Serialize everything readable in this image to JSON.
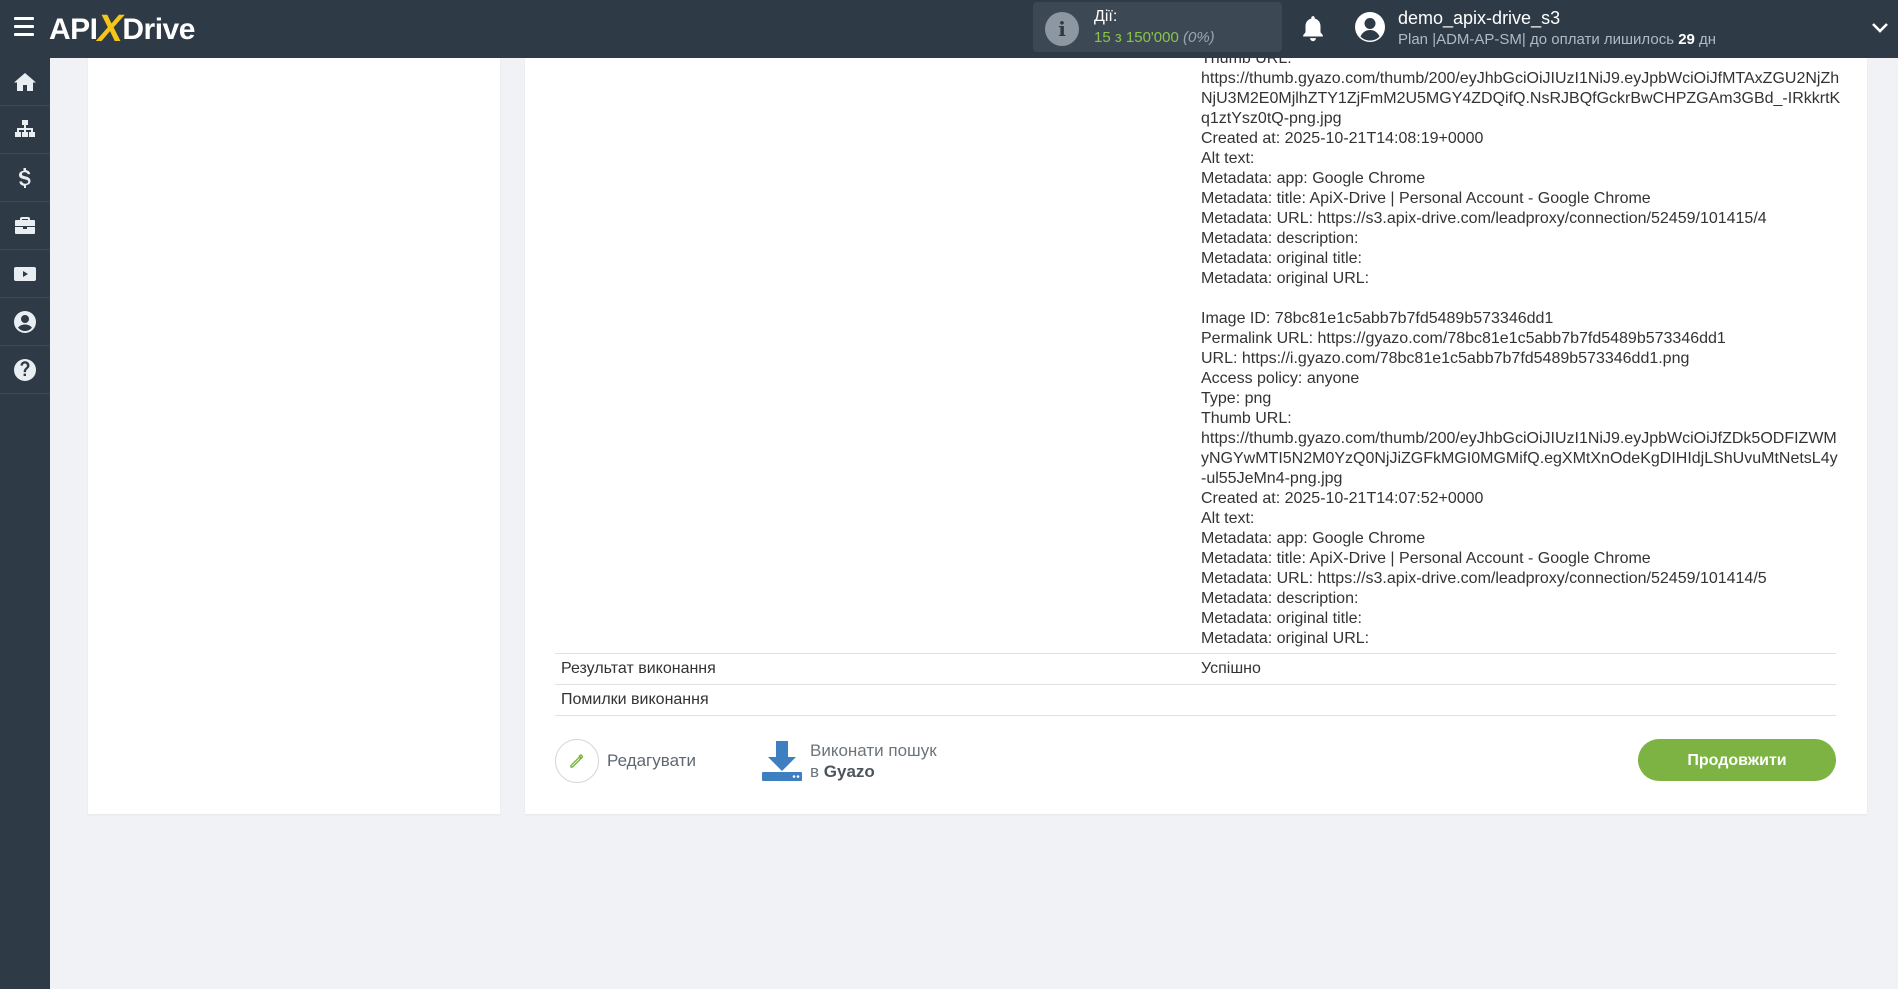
{
  "header": {
    "logo_left": "API",
    "logo_x": "X",
    "logo_right": "Drive",
    "actions_label": "Дії:",
    "actions_used": "15 з 150'000",
    "actions_percent": "(0%)",
    "user_name": "demo_apix-drive_s3",
    "plan_prefix": "Plan |ADM-AP-SM| до оплати лишилось",
    "plan_days": "29",
    "plan_days_unit": "дн",
    "icons": [
      "menu-icon",
      "info-icon",
      "bell-icon",
      "user-avatar-icon",
      "chevron-down-icon"
    ]
  },
  "sidenav": {
    "items": [
      {
        "icon": "home-icon"
      },
      {
        "icon": "sitemap-icon"
      },
      {
        "icon": "dollar-icon"
      },
      {
        "icon": "briefcase-icon"
      },
      {
        "icon": "youtube-icon"
      },
      {
        "icon": "account-icon"
      },
      {
        "icon": "help-icon"
      }
    ]
  },
  "result": {
    "lines": [
      "Thumb URL:",
      "https://thumb.gyazo.com/thumb/200/eyJhbGciOiJIUzI1NiJ9.eyJpbWciOiJfMTAxZGU2NjZhNjU3M2E0MjlhZTY1ZjFmM2U5MGY4ZDQifQ.NsRJBQfGckrBwCHPZGAm3GBd_-IRkkrtKq1ztYsz0tQ-png.jpg",
      "Created at: 2025-10-21T14:08:19+0000",
      "Alt text:",
      "Metadata: app: Google Chrome",
      "Metadata: title: ApiX-Drive | Personal Account - Google Chrome",
      "Metadata: URL: https://s3.apix-drive.com/leadproxy/connection/52459/101415/4",
      "Metadata: description:",
      "Metadata: original title:",
      "Metadata: original URL:",
      "",
      "Image ID: 78bc81e1c5abb7b7fd5489b573346dd1",
      "Permalink URL: https://gyazo.com/78bc81e1c5abb7b7fd5489b573346dd1",
      "URL: https://i.gyazo.com/78bc81e1c5abb7b7fd5489b573346dd1.png",
      "Access policy: anyone",
      "Type: png",
      "Thumb URL:",
      "https://thumb.gyazo.com/thumb/200/eyJhbGciOiJIUzI1NiJ9.eyJpbWciOiJfZDk5ODFIZWMyNGYwMTI5N2M0YzQ0NjJiZGFkMGI0MGMifQ.egXMtXnOdeKgDIHIdjLShUvuMtNetsL4y-ul55JeMn4-png.jpg",
      "Created at: 2025-10-21T14:07:52+0000",
      "Alt text:",
      "Metadata: app: Google Chrome",
      "Metadata: title: ApiX-Drive | Personal Account - Google Chrome",
      "Metadata: URL: https://s3.apix-drive.com/leadproxy/connection/52459/101414/5",
      "Metadata: description:",
      "Metadata: original title:",
      "Metadata: original URL:"
    ],
    "status_label": "Результат виконання",
    "status_value": "Успішно",
    "errors_label": "Помилки виконання",
    "errors_value": ""
  },
  "buttons": {
    "edit_label": "Редагувати",
    "search_line1": "Виконати пошук",
    "search_prefix": "в",
    "search_service": "Gyazo",
    "continue_label": "Продовжити"
  },
  "colors": {
    "topbar": "#2e3a45",
    "accent_green": "#7cb342",
    "usage_green": "#8bc34a",
    "search_icon_blue": "#3d7fc1"
  }
}
